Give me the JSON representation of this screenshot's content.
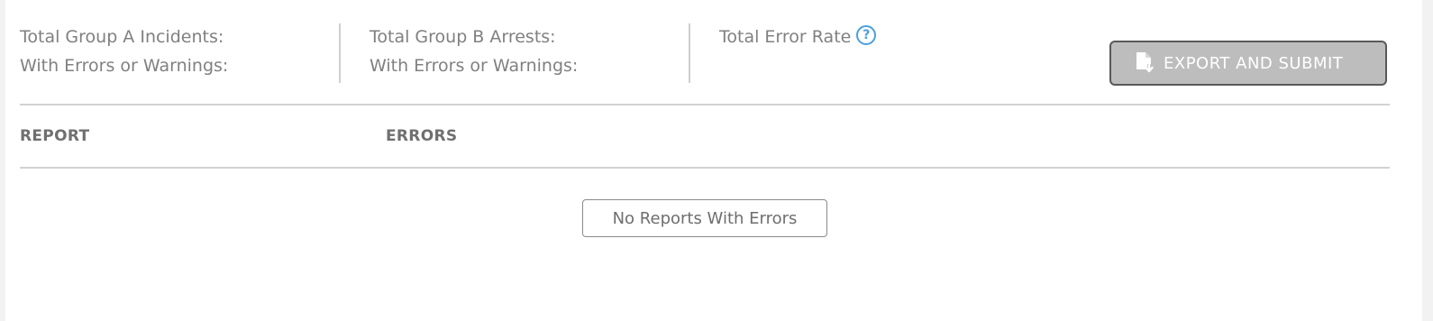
{
  "summary": {
    "group_a": {
      "line1": "Total Group A Incidents:",
      "line2": "With Errors or Warnings:"
    },
    "group_b": {
      "line1": "Total Group B Arrests:",
      "line2": "With Errors or Warnings:"
    },
    "error_rate": {
      "label": "Total Error Rate",
      "help_icon": "question-circle-icon",
      "help_glyph": "?"
    }
  },
  "actions": {
    "export_label": "EXPORT AND SUBMIT",
    "export_icon": "file-download-icon"
  },
  "table": {
    "columns": [
      "REPORT",
      "ERRORS"
    ],
    "empty_message": "No Reports With Errors"
  },
  "colors": {
    "accent": "#4a9fe0",
    "button_bg": "#bdbdbd",
    "button_border": "#595959"
  }
}
